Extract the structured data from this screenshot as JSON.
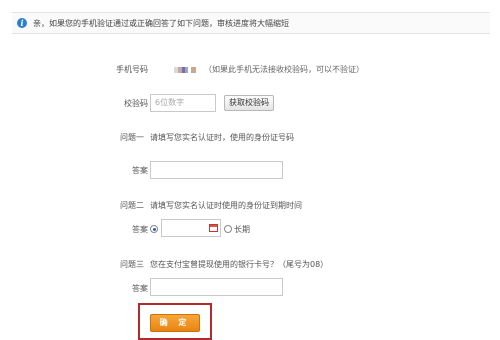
{
  "notice": {
    "icon": "info-icon",
    "text": "亲，如果您的手机验证通过或正确回答了如下问题，审核进度将大幅缩短"
  },
  "phone": {
    "label": "手机号码",
    "hint": "（如果此手机无法接收校验码，可以不验证）",
    "masked_colors": [
      "#d9d9d9",
      "#c8a8a0",
      "#6f6fb0",
      "#9aaab8",
      "#c8a890"
    ]
  },
  "verify": {
    "label": "校验码",
    "placeholder": "6位数字",
    "button": "获取校验码"
  },
  "q1": {
    "number": "问题一",
    "text": "请填写您实名认证时，使用的身份证号码",
    "answer_label": "答案",
    "answer_value": ""
  },
  "q2": {
    "number": "问题二",
    "text": "请填写您实名认证时使用的身份证到期时间",
    "answer_label": "答案",
    "date_value": "",
    "option_longterm": "长期"
  },
  "q3": {
    "number": "问题三",
    "text": "您在支付宝曾提现使用的银行卡号？（尾号为08）",
    "answer_label": "答案",
    "answer_value": ""
  },
  "confirm": {
    "label": "确 定"
  },
  "colors": {
    "accent_orange": "#f29a27",
    "highlight_red": "#b42a2a",
    "info_blue": "#2b7fd0"
  }
}
